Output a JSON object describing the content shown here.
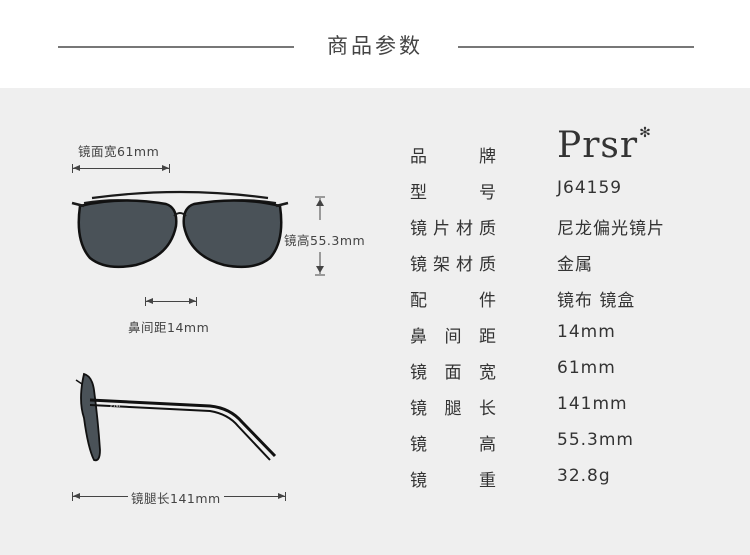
{
  "header": {
    "title": "商品参数"
  },
  "dimensions": {
    "lens_width": "镜面宽61mm",
    "lens_height": "镜高55.3mm",
    "bridge": "鼻间距14mm",
    "temple": "镜腿长141mm"
  },
  "specs": [
    {
      "label": "品牌",
      "value": "Prsr"
    },
    {
      "label": "型号",
      "value": "J64159"
    },
    {
      "label": "镜片材质",
      "value": "尼龙偏光镜片"
    },
    {
      "label": "镜架材质",
      "value": "金属"
    },
    {
      "label": "配件",
      "value": "镜布 镜盒"
    },
    {
      "label": "鼻间距",
      "value": "14mm"
    },
    {
      "label": "镜面宽",
      "value": "61mm"
    },
    {
      "label": "镜腿长",
      "value": "141mm"
    },
    {
      "label": "镜高",
      "value": "55.3mm"
    },
    {
      "label": "镜重",
      "value": "32.8g"
    }
  ],
  "brand_mark": "✻",
  "temple_logo": "Prsr",
  "colors": {
    "background": "#efefef",
    "text": "#333333",
    "frame": "#1a1a1a",
    "lens": "#4a5258"
  }
}
